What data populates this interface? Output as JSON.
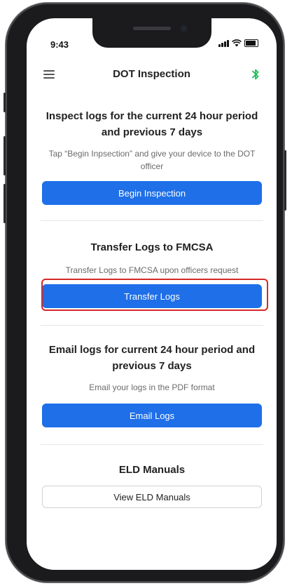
{
  "status_bar": {
    "time": "9:43"
  },
  "header": {
    "title": "DOT Inspection",
    "menu_icon": "hamburger-icon",
    "bluetooth_icon": "bluetooth-icon",
    "bluetooth_color": "#1fbf5a"
  },
  "inspect": {
    "title": "Inspect logs for the current 24 hour period and previous 7 days",
    "subtitle": "Tap “Begin Inpsection” and give your device to the DOT officer",
    "button": "Begin Inspection"
  },
  "transfer": {
    "title": "Transfer Logs to FMCSA",
    "subtitle": "Transfer Logs to FMCSA upon officers request",
    "button": "Transfer Logs"
  },
  "email": {
    "title": "Email logs for current 24 hour period and previous 7 days",
    "subtitle": "Email your logs in the PDF format",
    "button": "Email Logs"
  },
  "manuals": {
    "title": "ELD Manuals",
    "button": "View ELD Manuals"
  },
  "colors": {
    "primary": "#1e6fe8",
    "highlight": "#d62828"
  }
}
